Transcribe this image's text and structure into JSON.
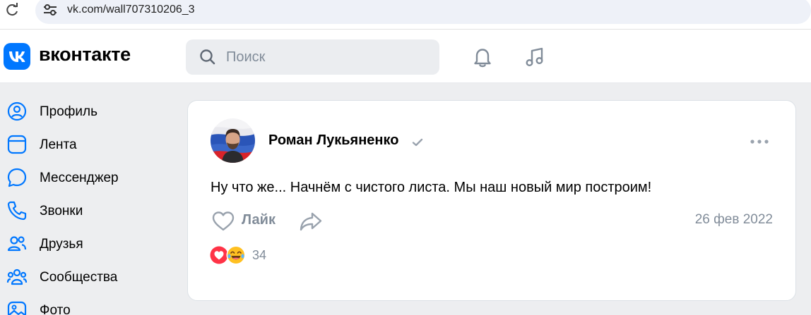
{
  "browser": {
    "url": "vk.com/wall707310206_3"
  },
  "header": {
    "brand": "вконтакте",
    "search_placeholder": "Поиск",
    "accent_color": "#0077ff"
  },
  "sidebar": {
    "items": [
      {
        "label": "Профиль",
        "icon": "profile-icon"
      },
      {
        "label": "Лента",
        "icon": "feed-icon"
      },
      {
        "label": "Мессенджер",
        "icon": "messenger-icon"
      },
      {
        "label": "Звонки",
        "icon": "phone-icon"
      },
      {
        "label": "Друзья",
        "icon": "friends-icon"
      },
      {
        "label": "Сообщества",
        "icon": "communities-icon"
      },
      {
        "label": "Фото",
        "icon": "photo-icon"
      }
    ]
  },
  "post": {
    "author": "Роман Лукьяненко",
    "text": "Ну что же... Начнём с чистого листа. Мы наш новый мир построим!",
    "like_label": "Лайк",
    "date": "26 фев 2022",
    "reactions_count": "34"
  }
}
